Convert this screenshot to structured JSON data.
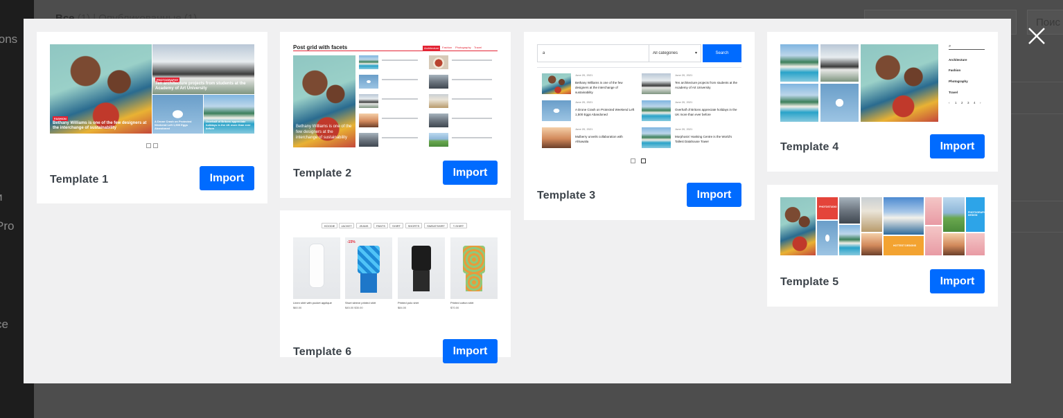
{
  "background": {
    "filters_all": "Все",
    "filters_all_count": "(1)",
    "filters_separator": "|",
    "filters_published": "Опубликованные",
    "filters_published_count": "(1)",
    "search_button": "Поис",
    "sidebar_fragments": [
      "ions",
      "и",
      "Pro",
      "ce"
    ]
  },
  "modal": {
    "close_icon": "close-x-icon",
    "accent_color": "#006bff"
  },
  "templates": [
    {
      "label": "Template 1",
      "import_label": "Import",
      "preview": {
        "tag1": "PHOTOGRAPHY",
        "caption1": "Ten architecture projects from students at the Academy of Art University",
        "tag2": "FASHION",
        "caption2": "Bethany Williams is one of the few designers at the interchange of sustainability",
        "caption3": "A Drone Crash on Protected Weekend Left 1,500 Eggs Abandoned",
        "caption4": "Overhalf of Britons appreciate holidays in the UK more than ever before"
      }
    },
    {
      "label": "Template 2",
      "import_label": "Import",
      "preview": {
        "heading": "Post grid with facets",
        "filters": [
          "Architecture",
          "Fashion",
          "Photography",
          "Travel"
        ],
        "caption": "Bethany Williams is one of the few designers at the interchange of sustainability"
      }
    },
    {
      "label": "Template 3",
      "import_label": "Import",
      "preview": {
        "search_value": "a",
        "category_select": "All categories",
        "search_button": "Search",
        "date": "June 20, 2021",
        "posts": [
          "Bethany Williams is one of the few designers at the interchange of sustainability",
          "Ten architecture projects from students at the Academy of Art University",
          "A Drone Crash on Protected Weekend Left 1,500 Eggs Abandoned",
          "Overhalf of Britons appreciate holidays in the UK more than ever before",
          "Mulberry unveils collaboration with Ahluwalia",
          "Morphosis' Hanking Centre is the World's Tallest Datahouse Tower"
        ]
      }
    },
    {
      "label": "Template 4",
      "import_label": "Import",
      "preview": {
        "categories": [
          "Architecture",
          "Fashion",
          "Photography",
          "Travel"
        ],
        "pages": [
          "‹",
          "1",
          "2",
          "3",
          "4",
          "›"
        ]
      }
    },
    {
      "label": "Template 5",
      "import_label": "Import",
      "preview": {
        "tile_labels": [
          "PHOTOSTUDIO",
          "HOTTEST DESIGNS",
          "PHOTOGRAPHY DESIGN"
        ]
      }
    },
    {
      "label": "Template 6",
      "import_label": "Import",
      "preview": {
        "tabs": [
          "HOODIE",
          "JACKET",
          "JEANS",
          "PANTS",
          "SHIRT",
          "SHORTS",
          "SWEATSHIRT",
          "T-SHIRT"
        ],
        "sale_badge": "-15%",
        "products": [
          {
            "name": "Linen shirt with pocket appliqué",
            "price": "$60.00"
          },
          {
            "name": "Short sleeve printed shirt",
            "price": "$45.00 $30.00"
          },
          {
            "name": "Printed polo shirt",
            "price": "$84.00"
          },
          {
            "name": "Printed cotton shirt",
            "price": "$70.00"
          }
        ]
      }
    }
  ]
}
